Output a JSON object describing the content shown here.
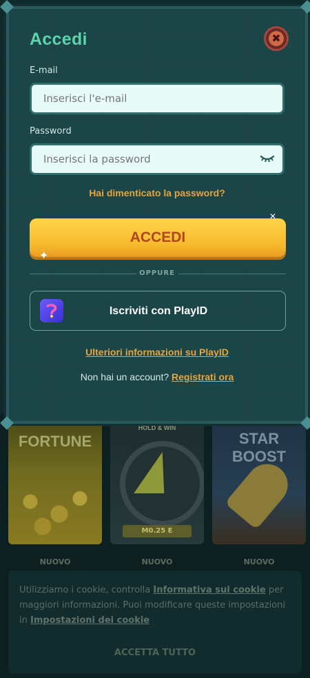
{
  "modal": {
    "title": "Accedi",
    "email": {
      "label": "E-mail",
      "placeholder": "Inserisci l'e-mail"
    },
    "password": {
      "label": "Password",
      "placeholder": "Inserisci la password"
    },
    "forgot_link": "Hai dimenticato la password?",
    "submit_label": "ACCEDI",
    "divider_label": "OPPURE",
    "playid_button": "Iscriviti con PlayID",
    "more_info_link": "Ulteriori informazioni su PlayID",
    "no_account_text": "Non hai un account?",
    "register_link": "Registrati ora",
    "close_icon": "close-icon",
    "colors": {
      "accent": "#e7a43d",
      "title": "#5dd3a8",
      "button": "#f7b92d"
    }
  },
  "games": {
    "tiles": [
      {
        "title": "FORTUNE",
        "badge": "NUOVO"
      },
      {
        "title": "HOLD & WIN",
        "amount": "M0.25 E",
        "badge": "NUOVO"
      },
      {
        "title": "STAR BOOST",
        "badge": "NUOVO"
      }
    ]
  },
  "cookie": {
    "text_1": "Utilizziamo i cookie, controlla ",
    "link_1": "Informativa sui cookie",
    "text_2": " per maggiori informazioni. Puoi modificare queste impostazioni in ",
    "link_2": "Impostazioni dei cookie",
    "accept_label": "ACCETTA TUTTO"
  }
}
